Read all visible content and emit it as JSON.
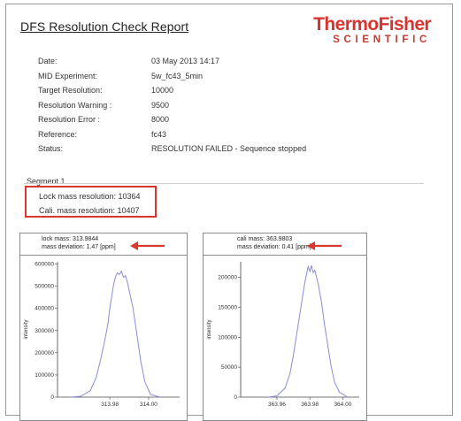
{
  "report": {
    "title": "DFS Resolution Check Report",
    "logo": {
      "brand": "ThermoFisher",
      "sub": "SCIENTIFIC"
    },
    "fields": [
      {
        "label": "Date:",
        "value": "03 May 2013   14:17"
      },
      {
        "label": "MID Experiment:",
        "value": "5w_fc43_5min"
      },
      {
        "label": "Target Resolution:",
        "value": "10000"
      },
      {
        "label": "Resolution Warning :",
        "value": "9500"
      },
      {
        "label": "Resolution Error  :",
        "value": "8000"
      },
      {
        "label": "Reference:",
        "value": "fc43"
      },
      {
        "label": "Status:",
        "value": "RESOLUTION FAILED - Sequence stopped"
      }
    ]
  },
  "segment": {
    "title": "Segment 1",
    "lock_line": "Lock mass resolution: 10364",
    "cali_line": "Cali. mass resolution: 10407"
  },
  "annotation_color": "#d9362e",
  "chart_data": [
    {
      "type": "line",
      "header_line1": "lock mass: 313.9844",
      "header_line2": "mass deviation: 1.47 [ppm]",
      "ylabel": "intensity",
      "ylim": [
        0,
        610000
      ],
      "xlim": [
        313.953,
        314.016
      ],
      "yticks": [
        0,
        100000,
        200000,
        300000,
        400000,
        500000,
        600000
      ],
      "xticks": [
        313.98,
        314.0
      ],
      "xtick_labels": [
        "313.98",
        "314.00"
      ],
      "series": [
        {
          "color": "#8a8ad8",
          "x": [
            313.96,
            313.965,
            313.97,
            313.973,
            313.975,
            313.977,
            313.979,
            313.98,
            313.981,
            313.982,
            313.983,
            313.984,
            313.985,
            313.986,
            313.987,
            313.988,
            313.989,
            313.99,
            313.992,
            313.994,
            313.996,
            313.998,
            314.001,
            314.006
          ],
          "y": [
            0,
            4000,
            30000,
            90000,
            160000,
            240000,
            330000,
            400000,
            455000,
            510000,
            545000,
            560000,
            553000,
            568000,
            540000,
            548000,
            520000,
            480000,
            400000,
            280000,
            160000,
            70000,
            12000,
            0
          ]
        }
      ]
    },
    {
      "type": "line",
      "header_line1": "cali mass: 363.9803",
      "header_line2": "mass deviation: 0.41 [ppm]",
      "ylabel": "intensity",
      "ylim": [
        0,
        226000
      ],
      "xlim": [
        363.938,
        364.01
      ],
      "yticks": [
        0,
        50000,
        100000,
        150000,
        200000
      ],
      "xticks": [
        363.96,
        363.98,
        364.0
      ],
      "xtick_labels": [
        "363.96",
        "363.98",
        "364.00"
      ],
      "series": [
        {
          "color": "#8a8ad8",
          "x": [
            363.955,
            363.96,
            363.965,
            363.968,
            363.97,
            363.972,
            363.974,
            363.976,
            363.977,
            363.978,
            363.979,
            363.98,
            363.981,
            363.982,
            363.983,
            363.985,
            363.987,
            363.989,
            363.991,
            363.993,
            363.995,
            363.998,
            364.003
          ],
          "y": [
            0,
            2000,
            15000,
            40000,
            70000,
            105000,
            140000,
            175000,
            192000,
            205000,
            218000,
            210000,
            220000,
            208000,
            212000,
            190000,
            160000,
            120000,
            85000,
            50000,
            25000,
            8000,
            0
          ]
        }
      ]
    }
  ]
}
